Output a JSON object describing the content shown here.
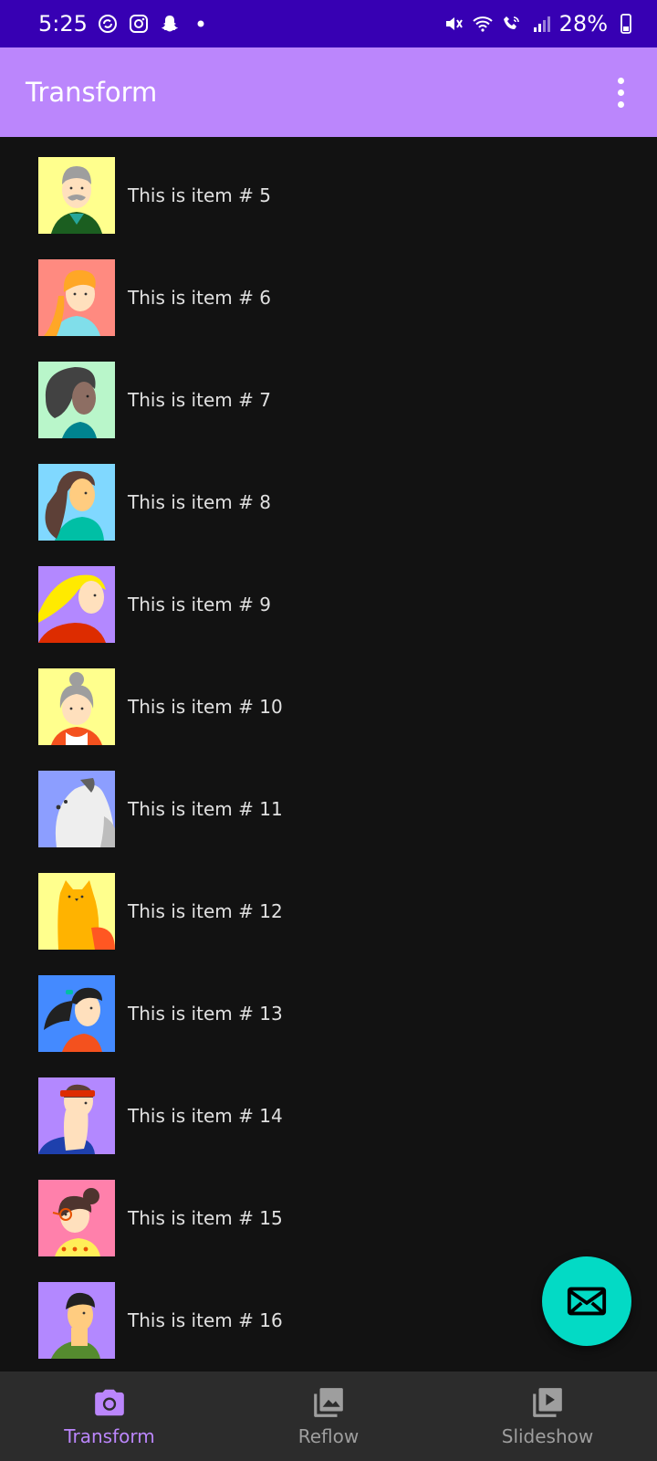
{
  "status_bar": {
    "time": "5:25",
    "battery": "28%",
    "left_icons": [
      "sync-icon",
      "instagram-icon",
      "snapchat-icon",
      "dot-icon"
    ],
    "right_icons": [
      "mute-icon",
      "wifi-icon",
      "wifi-calling-icon",
      "signal-icon",
      "battery-icon"
    ]
  },
  "app_bar": {
    "title": "Transform",
    "overflow_icon": "more-vert-icon"
  },
  "list": {
    "items": [
      {
        "label": "This is item # 5",
        "bg": "#ffff8d"
      },
      {
        "label": "This is item # 6",
        "bg": "#ff8a80"
      },
      {
        "label": "This is item # 7",
        "bg": "#b9f6ca"
      },
      {
        "label": "This is item # 8",
        "bg": "#80d8ff"
      },
      {
        "label": "This is item # 9",
        "bg": "#b388ff"
      },
      {
        "label": "This is item # 10",
        "bg": "#ffff8d"
      },
      {
        "label": "This is item # 11",
        "bg": "#8c9eff"
      },
      {
        "label": "This is item # 12",
        "bg": "#ffff8d"
      },
      {
        "label": "This is item # 13",
        "bg": "#448aff"
      },
      {
        "label": "This is item # 14",
        "bg": "#b388ff"
      },
      {
        "label": "This is item # 15",
        "bg": "#ff80ab"
      },
      {
        "label": "This is item # 16",
        "bg": "#b388ff"
      }
    ]
  },
  "fab": {
    "icon": "email-icon",
    "color": "#03dac5"
  },
  "bottom_nav": {
    "items": [
      {
        "label": "Transform",
        "icon": "camera-icon",
        "active": true
      },
      {
        "label": "Reflow",
        "icon": "image-icon",
        "active": false
      },
      {
        "label": "Slideshow",
        "icon": "slideshow-icon",
        "active": false
      }
    ]
  },
  "colors": {
    "status_bar": "#3700b3",
    "app_bar": "#bb86fc",
    "background": "#121212",
    "nav_active": "#bb86fc",
    "nav_inactive": "#9e9e9e"
  }
}
